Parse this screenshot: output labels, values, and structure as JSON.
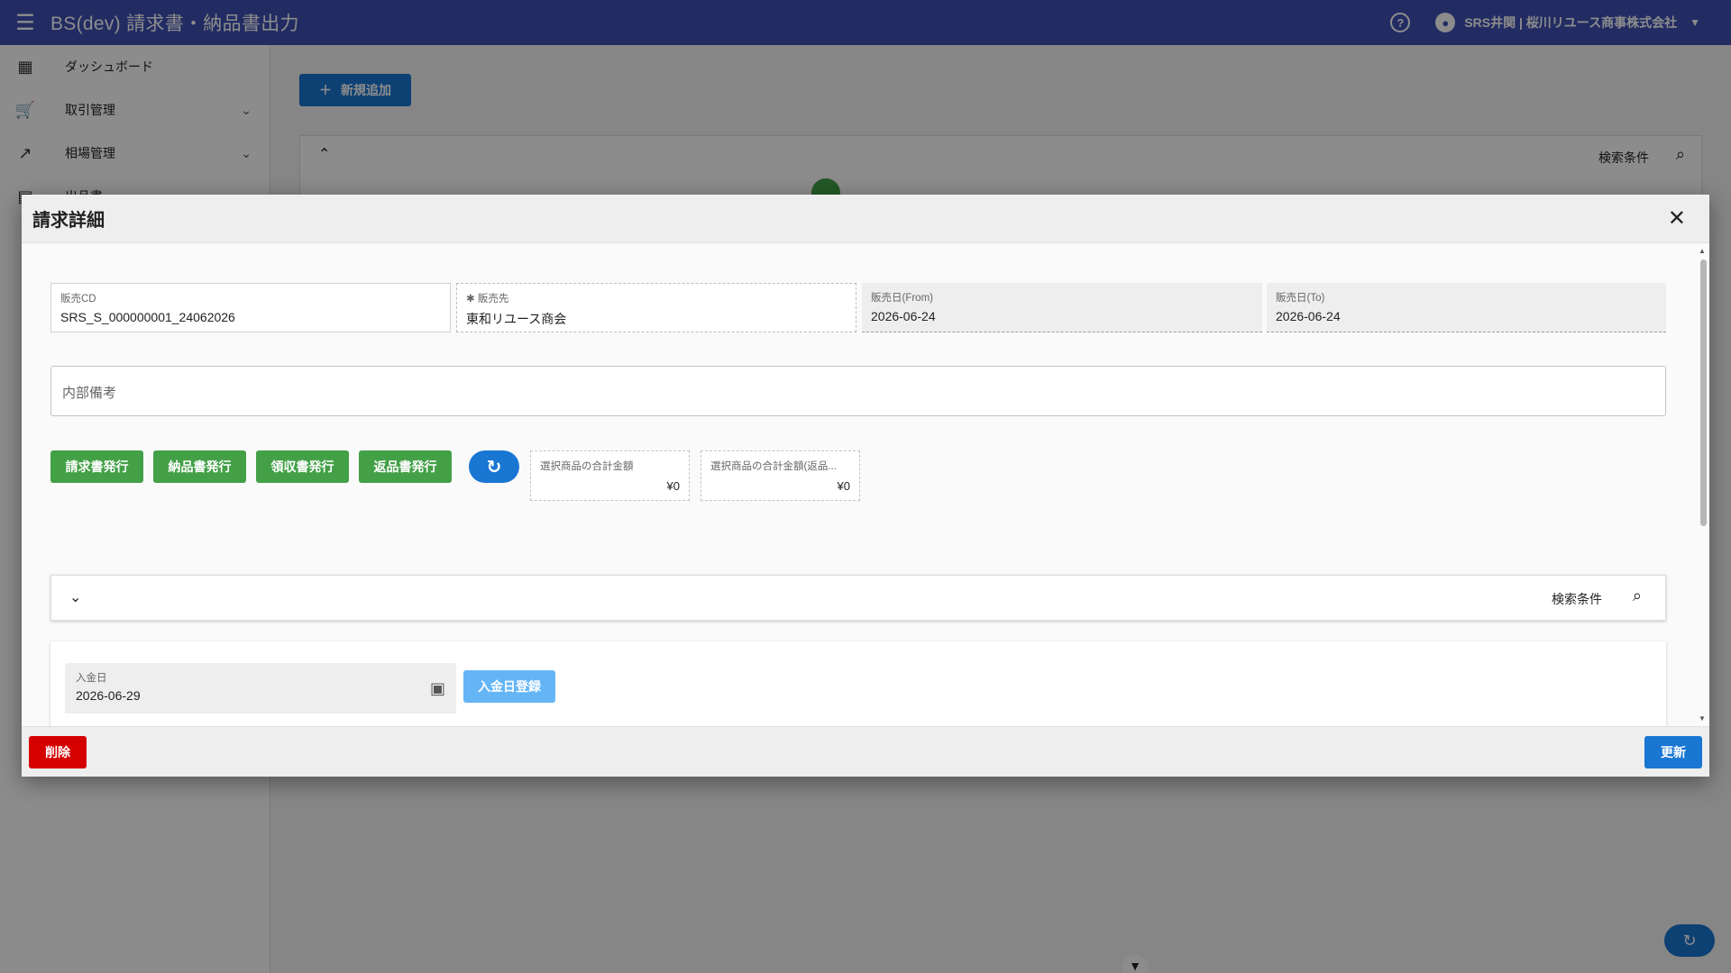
{
  "app": {
    "title": "BS(dev) 請求書・納品書出力",
    "user": "SRS井関 | 桜川リユース商事株式会社"
  },
  "sidebar": {
    "items": [
      {
        "label": "ダッシュボード"
      },
      {
        "label": "取引管理"
      },
      {
        "label": "相場管理"
      },
      {
        "label": "出品書"
      }
    ]
  },
  "page": {
    "add_button": "新規追加",
    "search_label": "検索条件"
  },
  "dialog": {
    "title": "請求詳細",
    "fields": {
      "sales_cd": {
        "label": "販売CD",
        "value": "SRS_S_000000001_24062026"
      },
      "customer": {
        "label": "販売先",
        "value": "東和リユース商会"
      },
      "date_from": {
        "label": "販売日(From)",
        "value": "2026-06-24"
      },
      "date_to": {
        "label": "販売日(To)",
        "value": "2026-06-24"
      },
      "memo": {
        "placeholder": "内部備考"
      }
    },
    "buttons": {
      "invoice": "請求書発行",
      "delivery": "納品書発行",
      "receipt": "領収書発行",
      "return": "返品書発行"
    },
    "totals": {
      "selected": {
        "label": "選択商品の合計金額",
        "value": "¥0"
      },
      "selected_return": {
        "label": "選択商品の合計金額(返品...",
        "value": "¥0"
      }
    },
    "search_label": "検索条件",
    "payment": {
      "label": "入金日",
      "value": "2026-06-29",
      "button": "入金日登録"
    },
    "footer": {
      "delete": "削除",
      "update": "更新"
    }
  }
}
